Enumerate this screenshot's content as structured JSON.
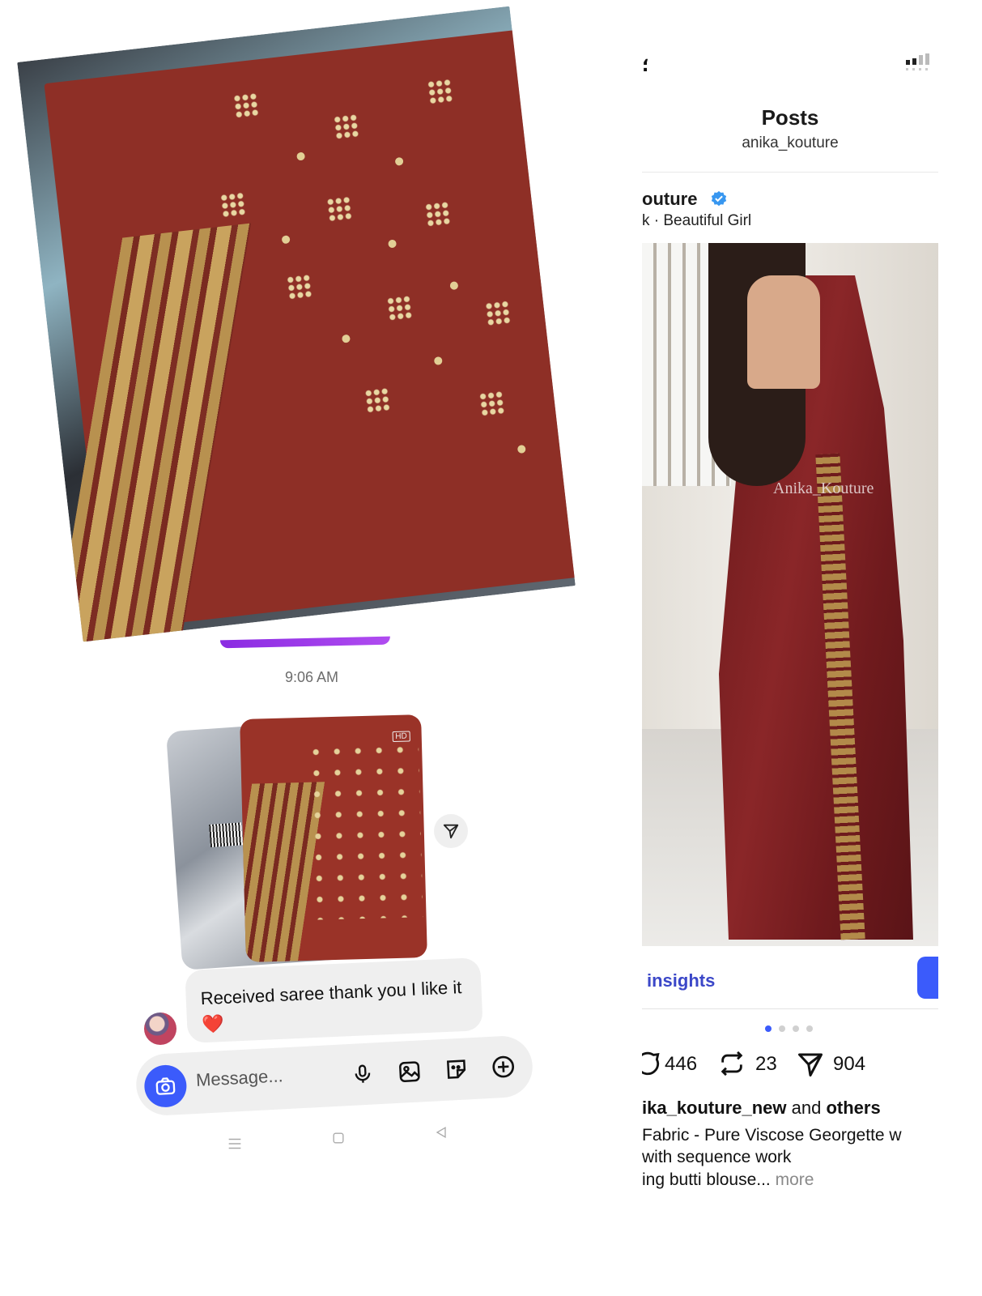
{
  "chat": {
    "timestamp": "9:06 AM",
    "hd_badge": "HD",
    "message_text": "Received saree thank you I like it ❤️",
    "composer_placeholder": "Message...",
    "icons": {
      "camera": "camera-icon",
      "mic": "microphone-icon",
      "gallery": "gallery-icon",
      "sticker": "sticker-icon",
      "plus": "add-icon",
      "share": "share-icon"
    },
    "accent_color": "#3b5bfb",
    "bubble_color": "#efefef"
  },
  "system_nav": {
    "menu": "menu-icon",
    "home": "home-icon",
    "back": "back-icon"
  },
  "post_screen": {
    "status_left": "؛",
    "title": "Posts",
    "subtitle": "anika_kouture",
    "account_name": "outure",
    "account_sub": "k · Beautiful Girl",
    "watermark": "Anika_Kouture",
    "insights_label": "insights",
    "comments_count": "446",
    "reposts_count": "23",
    "shares_count": "904",
    "liked_by_user": "ika_kouture_new",
    "liked_by_and": " and ",
    "liked_by_others": "others",
    "caption_line1": "Fabric - Pure Viscose Georgette w",
    "caption_line2": "with sequence work",
    "caption_line3": "ing butti blouse... ",
    "more_label": "more",
    "verified_color": "#3897f0",
    "link_color": "#3b47c8"
  }
}
